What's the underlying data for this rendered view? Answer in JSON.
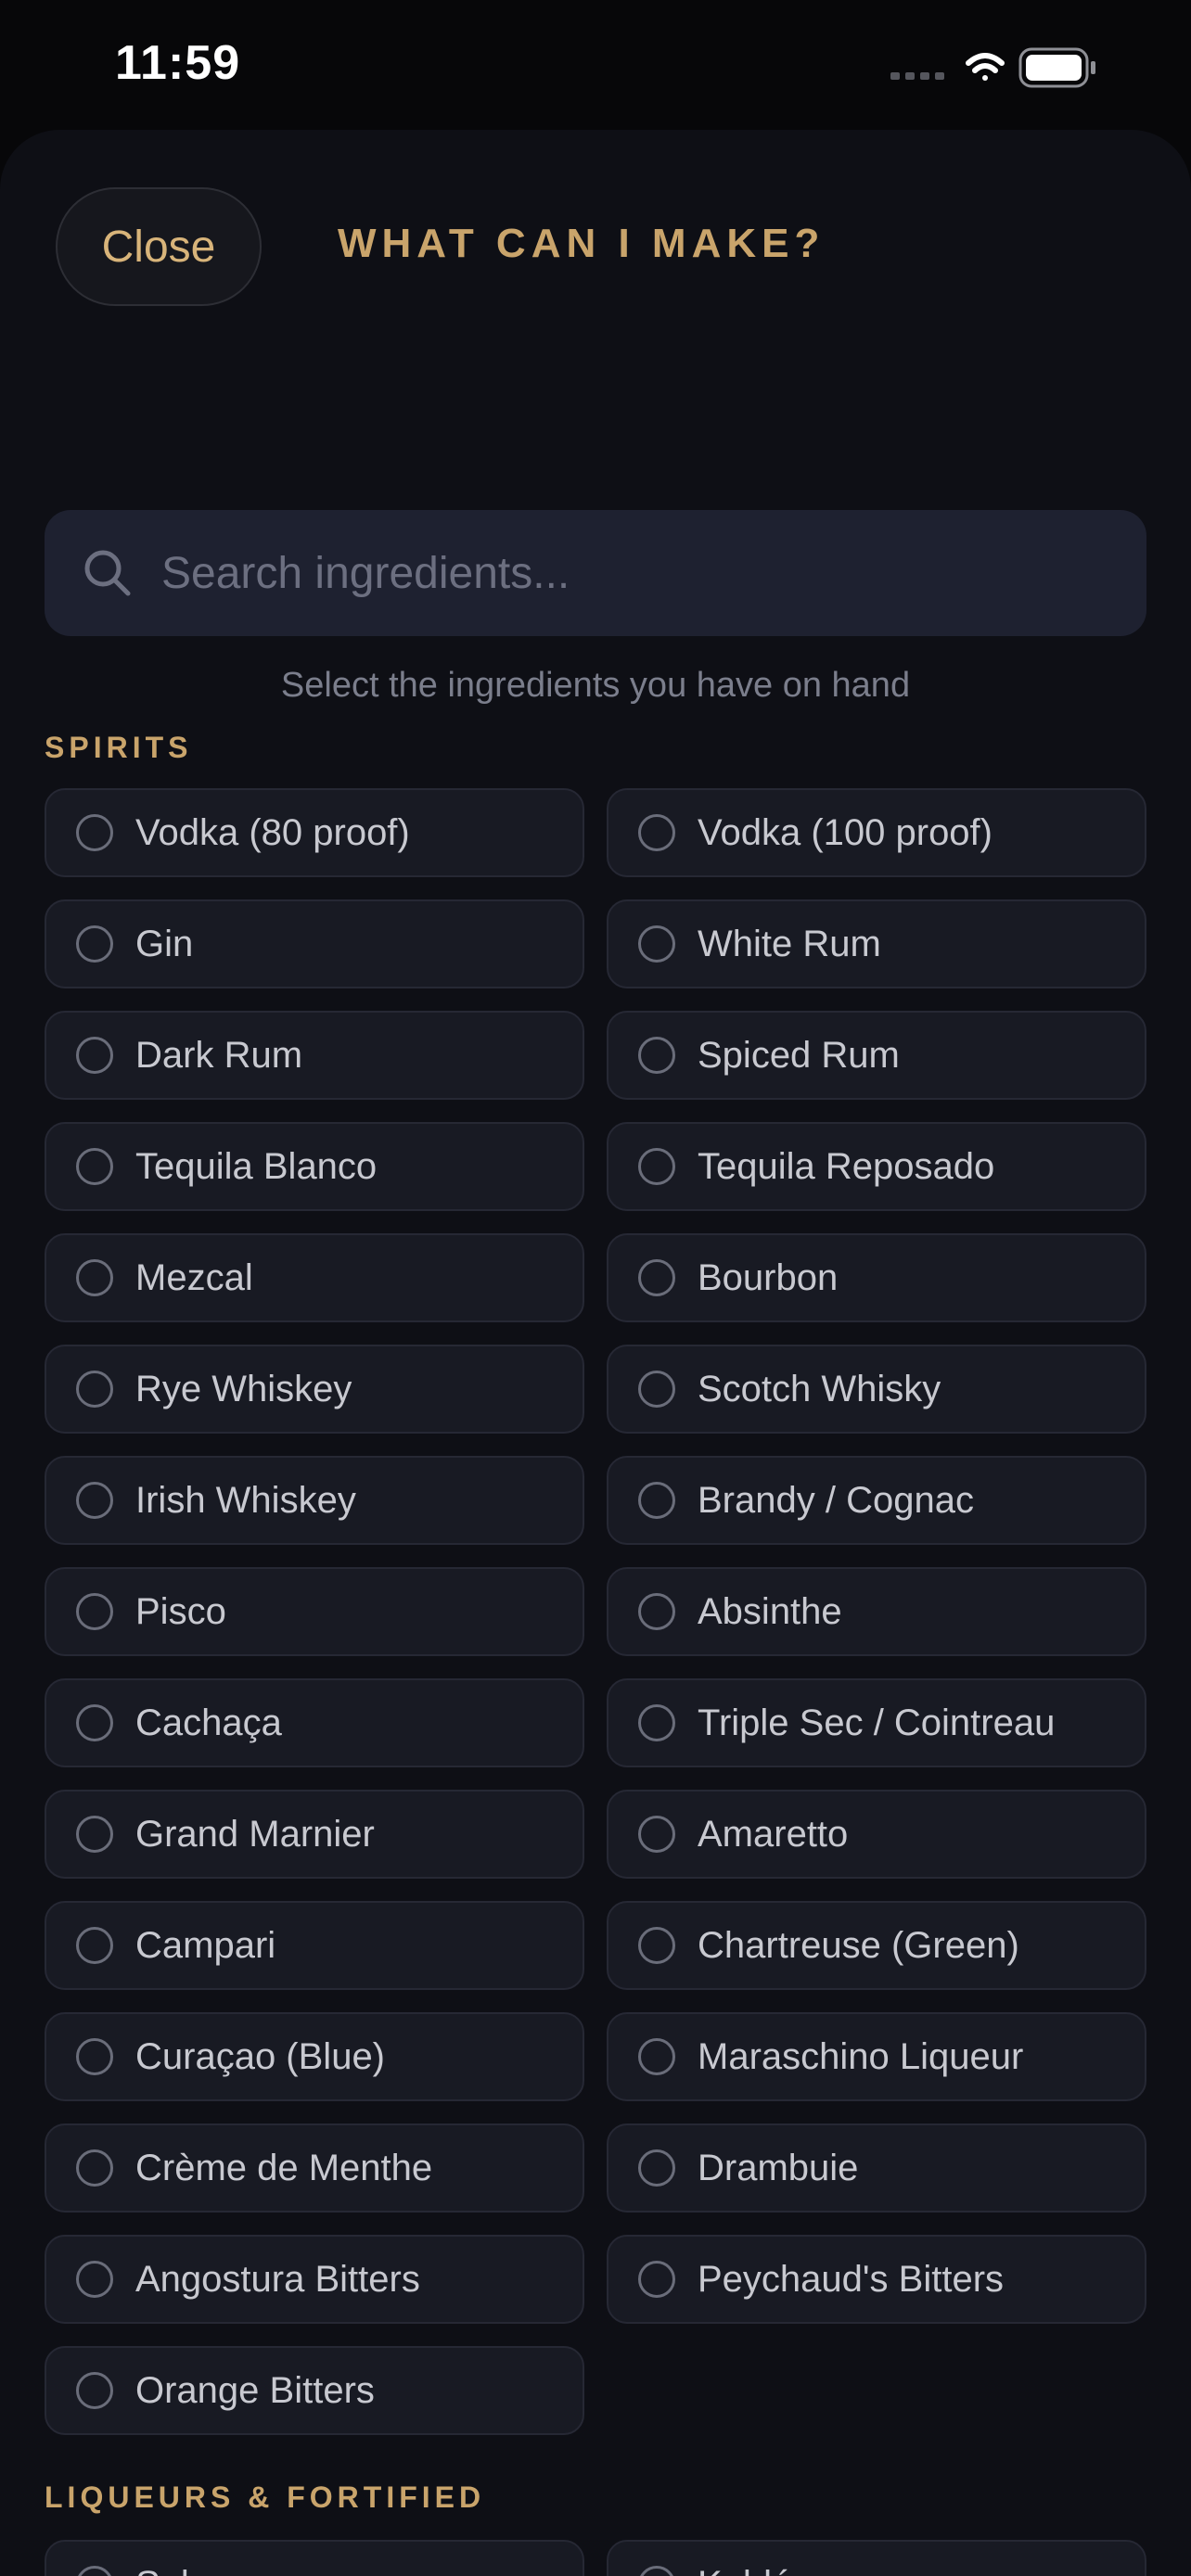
{
  "status_bar": {
    "time": "11:59"
  },
  "header": {
    "close_label": "Close",
    "title": "WHAT CAN I MAKE?"
  },
  "search": {
    "placeholder": "Search ingredients...",
    "value": ""
  },
  "hint": "Select the ingredients you have on hand",
  "sections": [
    {
      "heading": "SPIRITS",
      "items": [
        {
          "label": "Vodka (80 proof)",
          "selected": false
        },
        {
          "label": "Vodka (100 proof)",
          "selected": false
        },
        {
          "label": "Gin",
          "selected": false
        },
        {
          "label": "White Rum",
          "selected": false
        },
        {
          "label": "Dark Rum",
          "selected": false
        },
        {
          "label": "Spiced Rum",
          "selected": false
        },
        {
          "label": "Tequila Blanco",
          "selected": false
        },
        {
          "label": "Tequila Reposado",
          "selected": false
        },
        {
          "label": "Mezcal",
          "selected": false
        },
        {
          "label": "Bourbon",
          "selected": false
        },
        {
          "label": "Rye Whiskey",
          "selected": false
        },
        {
          "label": "Scotch Whisky",
          "selected": false
        },
        {
          "label": "Irish Whiskey",
          "selected": false
        },
        {
          "label": "Brandy / Cognac",
          "selected": false
        },
        {
          "label": "Pisco",
          "selected": false
        },
        {
          "label": "Absinthe",
          "selected": false
        },
        {
          "label": "Cachaça",
          "selected": false
        },
        {
          "label": "Triple Sec / Cointreau",
          "selected": false
        },
        {
          "label": "Grand Marnier",
          "selected": false
        },
        {
          "label": "Amaretto",
          "selected": false
        },
        {
          "label": "Campari",
          "selected": false
        },
        {
          "label": "Chartreuse (Green)",
          "selected": false
        },
        {
          "label": "Curaçao (Blue)",
          "selected": false
        },
        {
          "label": "Maraschino Liqueur",
          "selected": false
        },
        {
          "label": "Crème de Menthe",
          "selected": false
        },
        {
          "label": "Drambuie",
          "selected": false
        },
        {
          "label": "Angostura Bitters",
          "selected": false
        },
        {
          "label": "Peychaud's Bitters",
          "selected": false
        },
        {
          "label": "Orange Bitters",
          "selected": false
        }
      ]
    },
    {
      "heading": "LIQUEURS & FORTIFIED",
      "items": [
        {
          "label": "Sake",
          "selected": false
        },
        {
          "label": "Kahlúa",
          "selected": false
        }
      ]
    }
  ],
  "colors": {
    "accent": "#c9a46b",
    "background": "#0e0f15",
    "card": "#181a23"
  }
}
